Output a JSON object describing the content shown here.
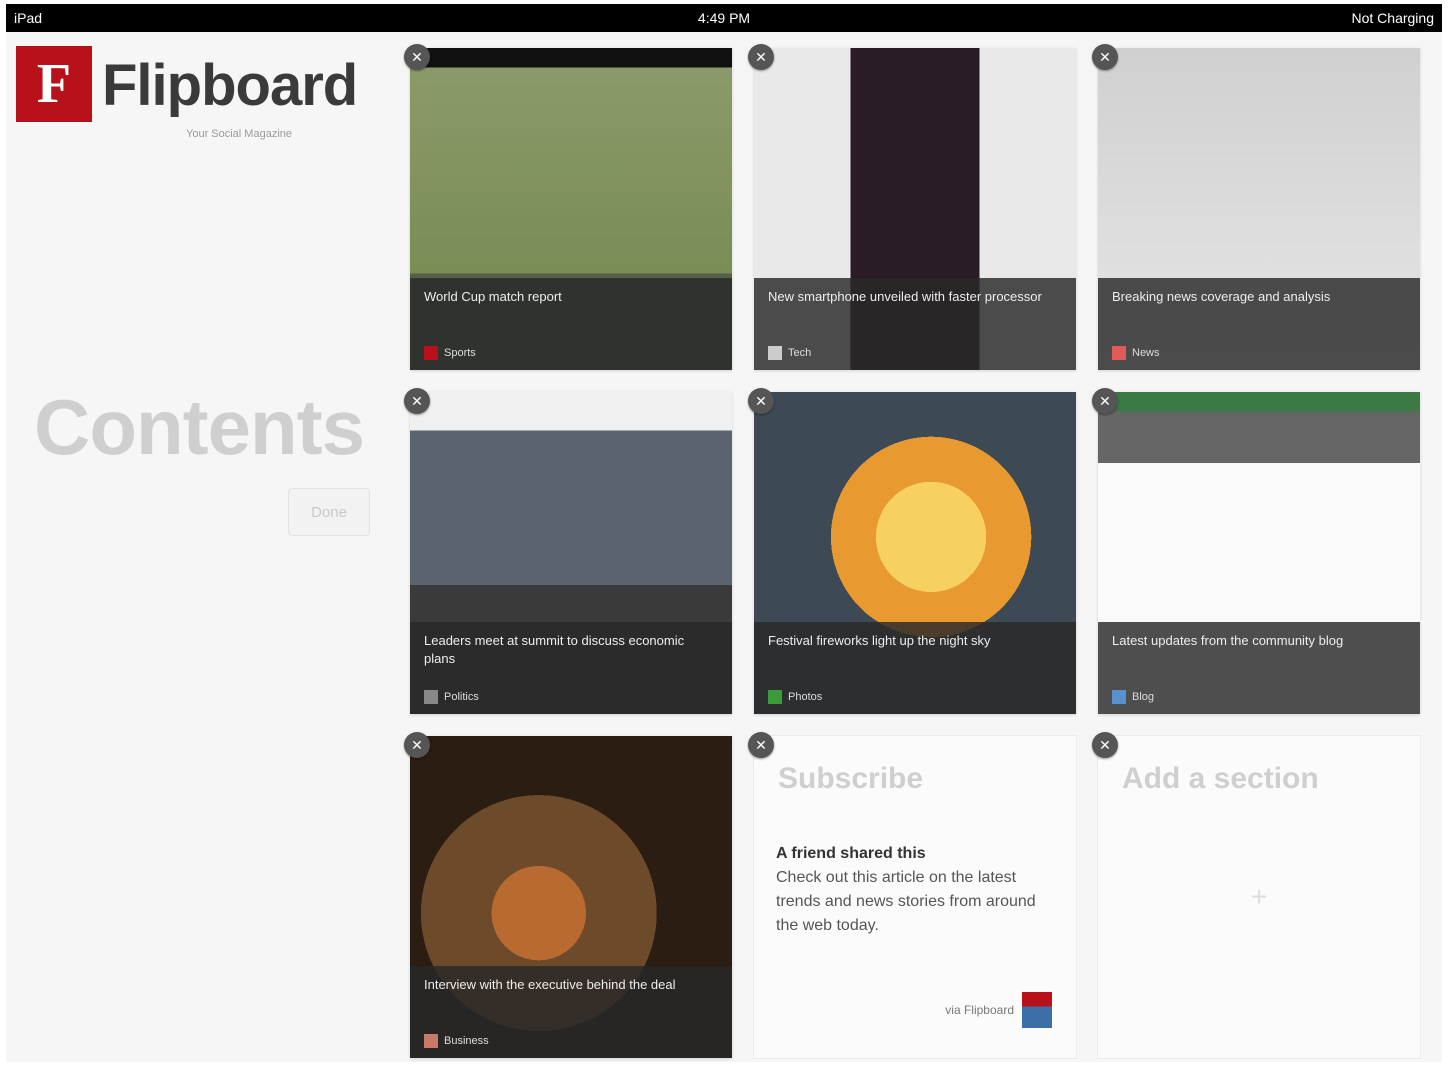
{
  "status_bar": {
    "left": "iPad",
    "center": "4:49 PM",
    "right": "Not Charging"
  },
  "brand": {
    "logo_letter": "F",
    "name": "Flipboard",
    "tagline": "Your Social Magazine"
  },
  "sidebar": {
    "title": "Contents",
    "done_label": "Done"
  },
  "remove_glyph": "✕",
  "add_glyph": "+",
  "tiles": [
    {
      "caption": "World Cup match report",
      "source": "Sports"
    },
    {
      "caption": "New smartphone unveiled with faster processor",
      "source": "Tech"
    },
    {
      "caption": "Breaking news coverage and analysis",
      "source": "News"
    },
    {
      "caption": "Leaders meet at summit to discuss economic plans",
      "source": "Politics"
    },
    {
      "caption": "Festival fireworks light up the night sky",
      "source": "Photos"
    },
    {
      "caption": "Latest updates from the community blog",
      "source": "Blog"
    },
    {
      "caption": "Interview with the executive behind the deal",
      "source": "Business"
    },
    {
      "title": "Subscribe",
      "feed_author": "A friend shared this",
      "feed_text": "Check out this article on the latest trends and news stories from around the web today.",
      "signature": "via Flipboard"
    },
    {
      "title": "Add a section"
    }
  ],
  "colors": {
    "brand_red": "#b8111c",
    "background": "#f6f6f6"
  }
}
